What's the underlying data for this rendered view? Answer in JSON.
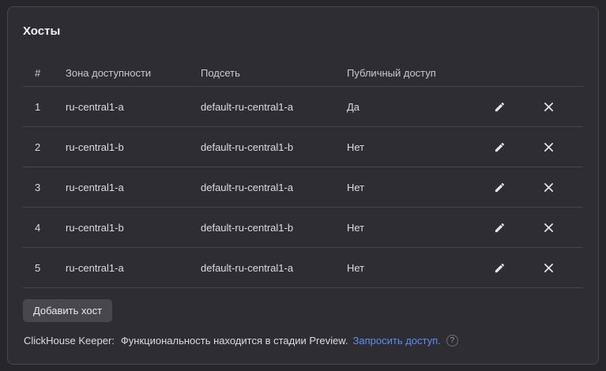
{
  "card": {
    "title": "Хосты"
  },
  "table": {
    "columns": [
      "#",
      "Зона доступности",
      "Подсеть",
      "Публичный доступ"
    ],
    "rows": [
      {
        "num": "1",
        "zone": "ru-central1-a",
        "subnet": "default-ru-central1-a",
        "public": "Да"
      },
      {
        "num": "2",
        "zone": "ru-central1-b",
        "subnet": "default-ru-central1-b",
        "public": "Нет"
      },
      {
        "num": "3",
        "zone": "ru-central1-a",
        "subnet": "default-ru-central1-a",
        "public": "Нет"
      },
      {
        "num": "4",
        "zone": "ru-central1-b",
        "subnet": "default-ru-central1-b",
        "public": "Нет"
      },
      {
        "num": "5",
        "zone": "ru-central1-a",
        "subnet": "default-ru-central1-a",
        "public": "Нет"
      }
    ],
    "row_icons": [
      "pencil-icon",
      "close-icon"
    ]
  },
  "add_button": {
    "label": "Добавить хост"
  },
  "keeper": {
    "label": "ClickHouse Keeper:",
    "text": "Функциональность находится в стадии Preview.",
    "link": "Запросить доступ.",
    "help": "?"
  },
  "colors": {
    "background": "#27262b",
    "card": "#2e2d33",
    "link": "#5c90ef",
    "button": "#48474e"
  }
}
